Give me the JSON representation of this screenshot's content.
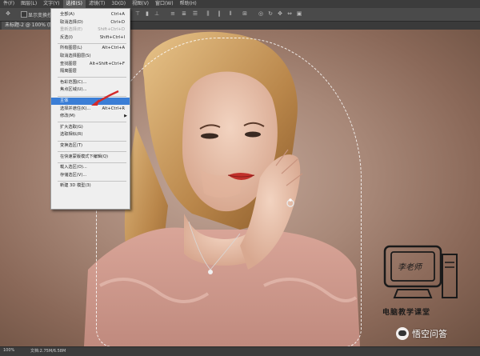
{
  "menubar": {
    "items": [
      "件(F)",
      "图层(L)",
      "文字(Y)",
      "选择(S)",
      "滤镜(T)",
      "3D(D)",
      "视图(V)",
      "窗口(W)",
      "帮助(H)"
    ],
    "active_index": 3
  },
  "optionsbar": {
    "checkbox_label": "显示变换控件"
  },
  "document_tab": {
    "label": "未标题-2 @ 100% (图层"
  },
  "select_menu": {
    "items": [
      {
        "label": "全部(A)",
        "shortcut": "Ctrl+A",
        "disabled": false,
        "highlight": false,
        "submenu": false
      },
      {
        "label": "取消选择(D)",
        "shortcut": "Ctrl+D",
        "disabled": false,
        "highlight": false,
        "submenu": false
      },
      {
        "label": "重新选择(E)",
        "shortcut": "Shift+Ctrl+D",
        "disabled": true,
        "highlight": false,
        "submenu": false
      },
      {
        "label": "反选(I)",
        "shortcut": "Shift+Ctrl+I",
        "disabled": false,
        "highlight": false,
        "submenu": false
      },
      {
        "label": "所有图层(L)",
        "shortcut": "Alt+Ctrl+A",
        "disabled": false,
        "highlight": false,
        "submenu": false
      },
      {
        "label": "取消选择图层(S)",
        "shortcut": "",
        "disabled": false,
        "highlight": false,
        "submenu": false
      },
      {
        "label": "查找图层",
        "shortcut": "Alt+Shift+Ctrl+F",
        "disabled": false,
        "highlight": false,
        "submenu": false
      },
      {
        "label": "隔离图层",
        "shortcut": "",
        "disabled": false,
        "highlight": false,
        "submenu": false
      },
      {
        "label": "色彩范围(C)...",
        "shortcut": "",
        "disabled": false,
        "highlight": false,
        "submenu": false
      },
      {
        "label": "焦点区域(U)...",
        "shortcut": "",
        "disabled": false,
        "highlight": false,
        "submenu": false
      },
      {
        "label": "主体",
        "shortcut": "",
        "disabled": false,
        "highlight": true,
        "submenu": false
      },
      {
        "label": "选择并遮住(K)...",
        "shortcut": "Alt+Ctrl+R",
        "disabled": false,
        "highlight": false,
        "submenu": false
      },
      {
        "label": "修改(M)",
        "shortcut": "",
        "disabled": false,
        "highlight": false,
        "submenu": true
      },
      {
        "label": "扩大选取(G)",
        "shortcut": "",
        "disabled": false,
        "highlight": false,
        "submenu": false
      },
      {
        "label": "选取相似(R)",
        "shortcut": "",
        "disabled": false,
        "highlight": false,
        "submenu": false
      },
      {
        "label": "变换选区(T)",
        "shortcut": "",
        "disabled": false,
        "highlight": false,
        "submenu": false
      },
      {
        "label": "在快速蒙版模式下编辑(Q)",
        "shortcut": "",
        "disabled": false,
        "highlight": false,
        "submenu": false
      },
      {
        "label": "载入选区(O)...",
        "shortcut": "",
        "disabled": false,
        "highlight": false,
        "submenu": false
      },
      {
        "label": "存储选区(V)...",
        "shortcut": "",
        "disabled": false,
        "highlight": false,
        "submenu": false
      },
      {
        "label": "新建 3D 模型(3)",
        "shortcut": "",
        "disabled": false,
        "highlight": false,
        "submenu": false
      }
    ],
    "separators_after": [
      3,
      7,
      9,
      12,
      14,
      15,
      16,
      18
    ]
  },
  "watermark_logo": {
    "text": "电脑教学课堂",
    "screen_text": "李老师"
  },
  "watermark_site": {
    "text": "悟空问答"
  },
  "statusbar": {
    "zoom": "100%",
    "doc_info": "文档:2.75M/6.58M"
  },
  "colors": {
    "highlight": "#3b7ed6",
    "menubar": "#3c3c3c",
    "backdrop": "#a88878"
  }
}
